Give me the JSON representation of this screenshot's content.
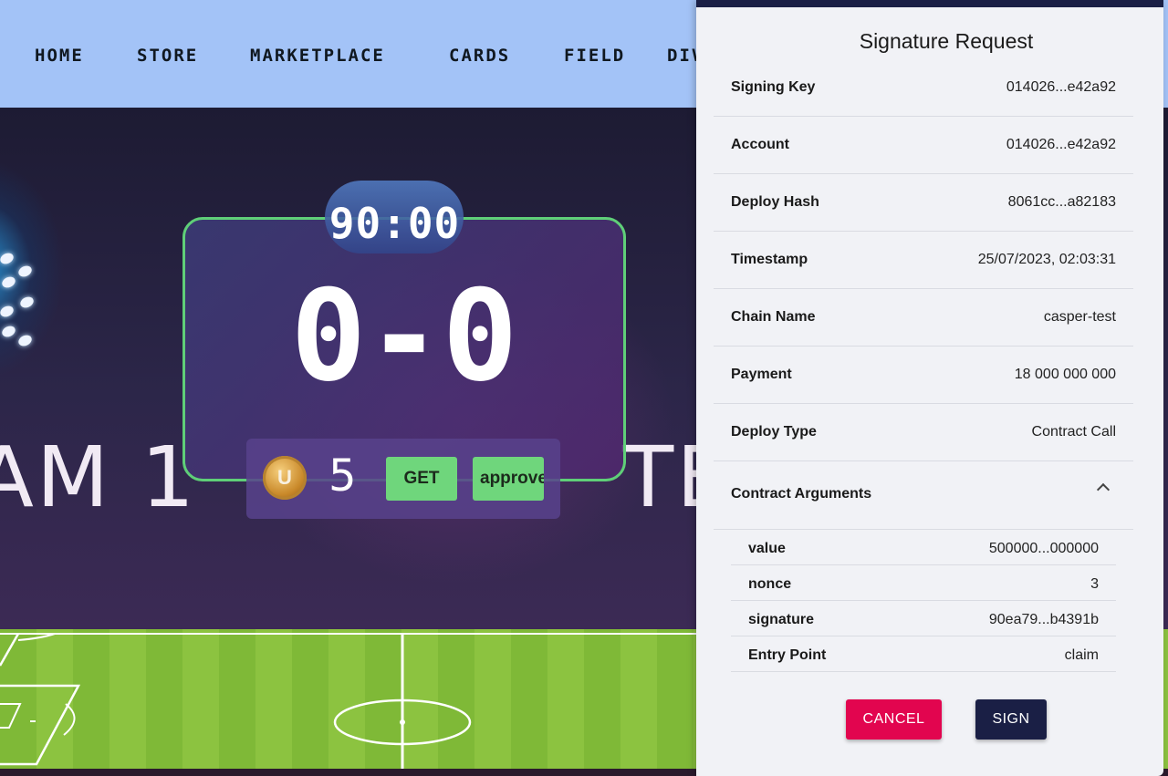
{
  "nav": {
    "items": [
      "HOME",
      "STORE",
      "MARKETPLACE",
      "CARDS",
      "FIELD",
      "DIV"
    ]
  },
  "game": {
    "timer": "90:00",
    "score": "0-0",
    "team_left": "AM 1",
    "team_right": "TE",
    "coin_icon": "coin-icon",
    "coin_letter": "U",
    "coin_count": "5",
    "get_label": "GET",
    "approve_label": "approve"
  },
  "modal": {
    "title": "Signature Request",
    "rows": [
      {
        "label": "Signing Key",
        "value": "014026...e42a92"
      },
      {
        "label": "Account",
        "value": "014026...e42a92"
      },
      {
        "label": "Deploy Hash",
        "value": "8061cc...a82183"
      },
      {
        "label": "Timestamp",
        "value": "25/07/2023, 02:03:31"
      },
      {
        "label": "Chain Name",
        "value": "casper-test"
      },
      {
        "label": "Payment",
        "value": "18 000 000 000"
      },
      {
        "label": "Deploy Type",
        "value": "Contract Call"
      }
    ],
    "contract_arguments": {
      "label": "Contract Arguments",
      "toggle_icon": "chevron-up-icon",
      "items": [
        {
          "label": "value",
          "value": "500000...000000"
        },
        {
          "label": "nonce",
          "value": "3"
        },
        {
          "label": "signature",
          "value": "90ea79...b4391b"
        },
        {
          "label": "Entry Point",
          "value": "claim"
        }
      ]
    },
    "cancel_label": "CANCEL",
    "sign_label": "SIGN"
  },
  "colors": {
    "nav_bg": "#a3c3f7",
    "score_border": "#5fcf78",
    "button_green": "#6fd67c",
    "cancel_red": "#e2054f",
    "sign_navy": "#1a1f45"
  }
}
